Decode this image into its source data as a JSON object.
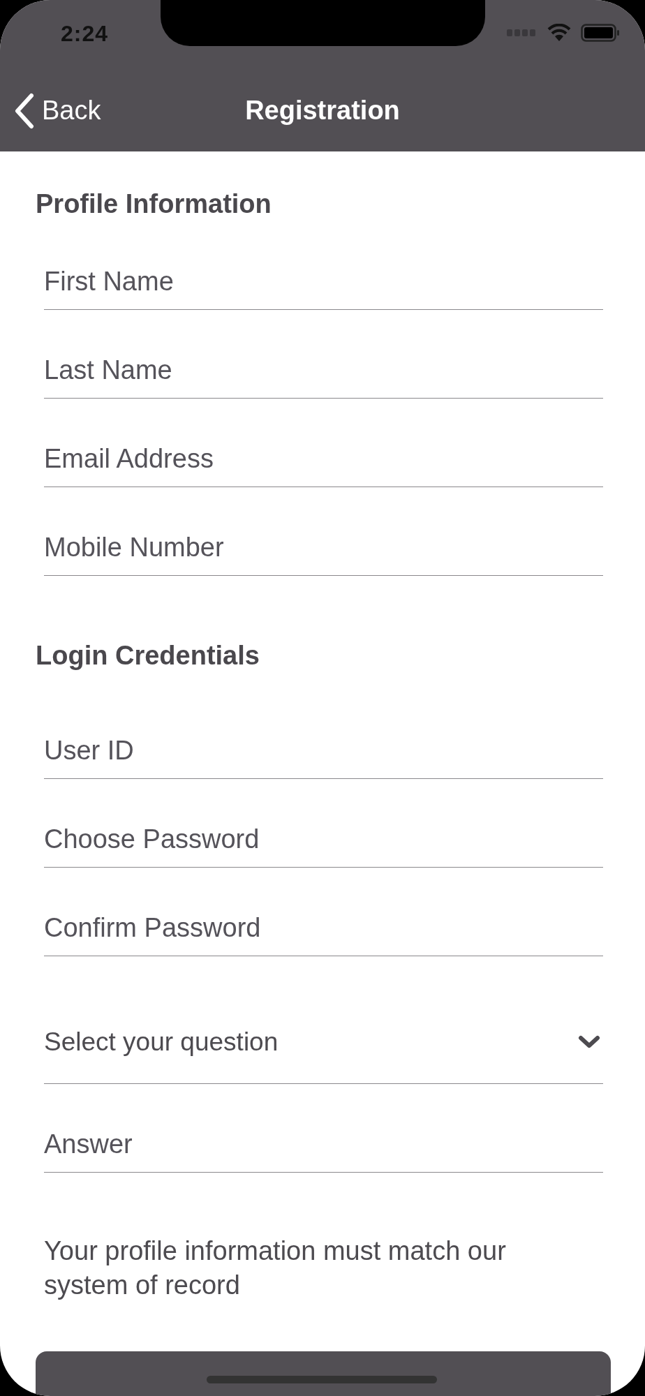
{
  "status_bar": {
    "time": "2:24"
  },
  "nav_bar": {
    "back": "Back",
    "title": "Registration"
  },
  "sections": [
    {
      "heading": "Profile Information",
      "fields": [
        {
          "kind": "text",
          "placeholder": "First Name"
        },
        {
          "kind": "text",
          "placeholder": "Last Name"
        },
        {
          "kind": "text",
          "placeholder": "Email Address"
        },
        {
          "kind": "text",
          "placeholder": "Mobile Number"
        }
      ]
    },
    {
      "heading": "Login Credentials",
      "fields": [
        {
          "kind": "text",
          "placeholder": "User ID"
        },
        {
          "kind": "text",
          "placeholder": "Choose Password"
        },
        {
          "kind": "text",
          "placeholder": "Confirm Password"
        },
        {
          "kind": "select",
          "placeholder": "Select your question"
        },
        {
          "kind": "text",
          "placeholder": "Answer"
        }
      ]
    }
  ],
  "note": "Your profile information must match our system of record"
}
